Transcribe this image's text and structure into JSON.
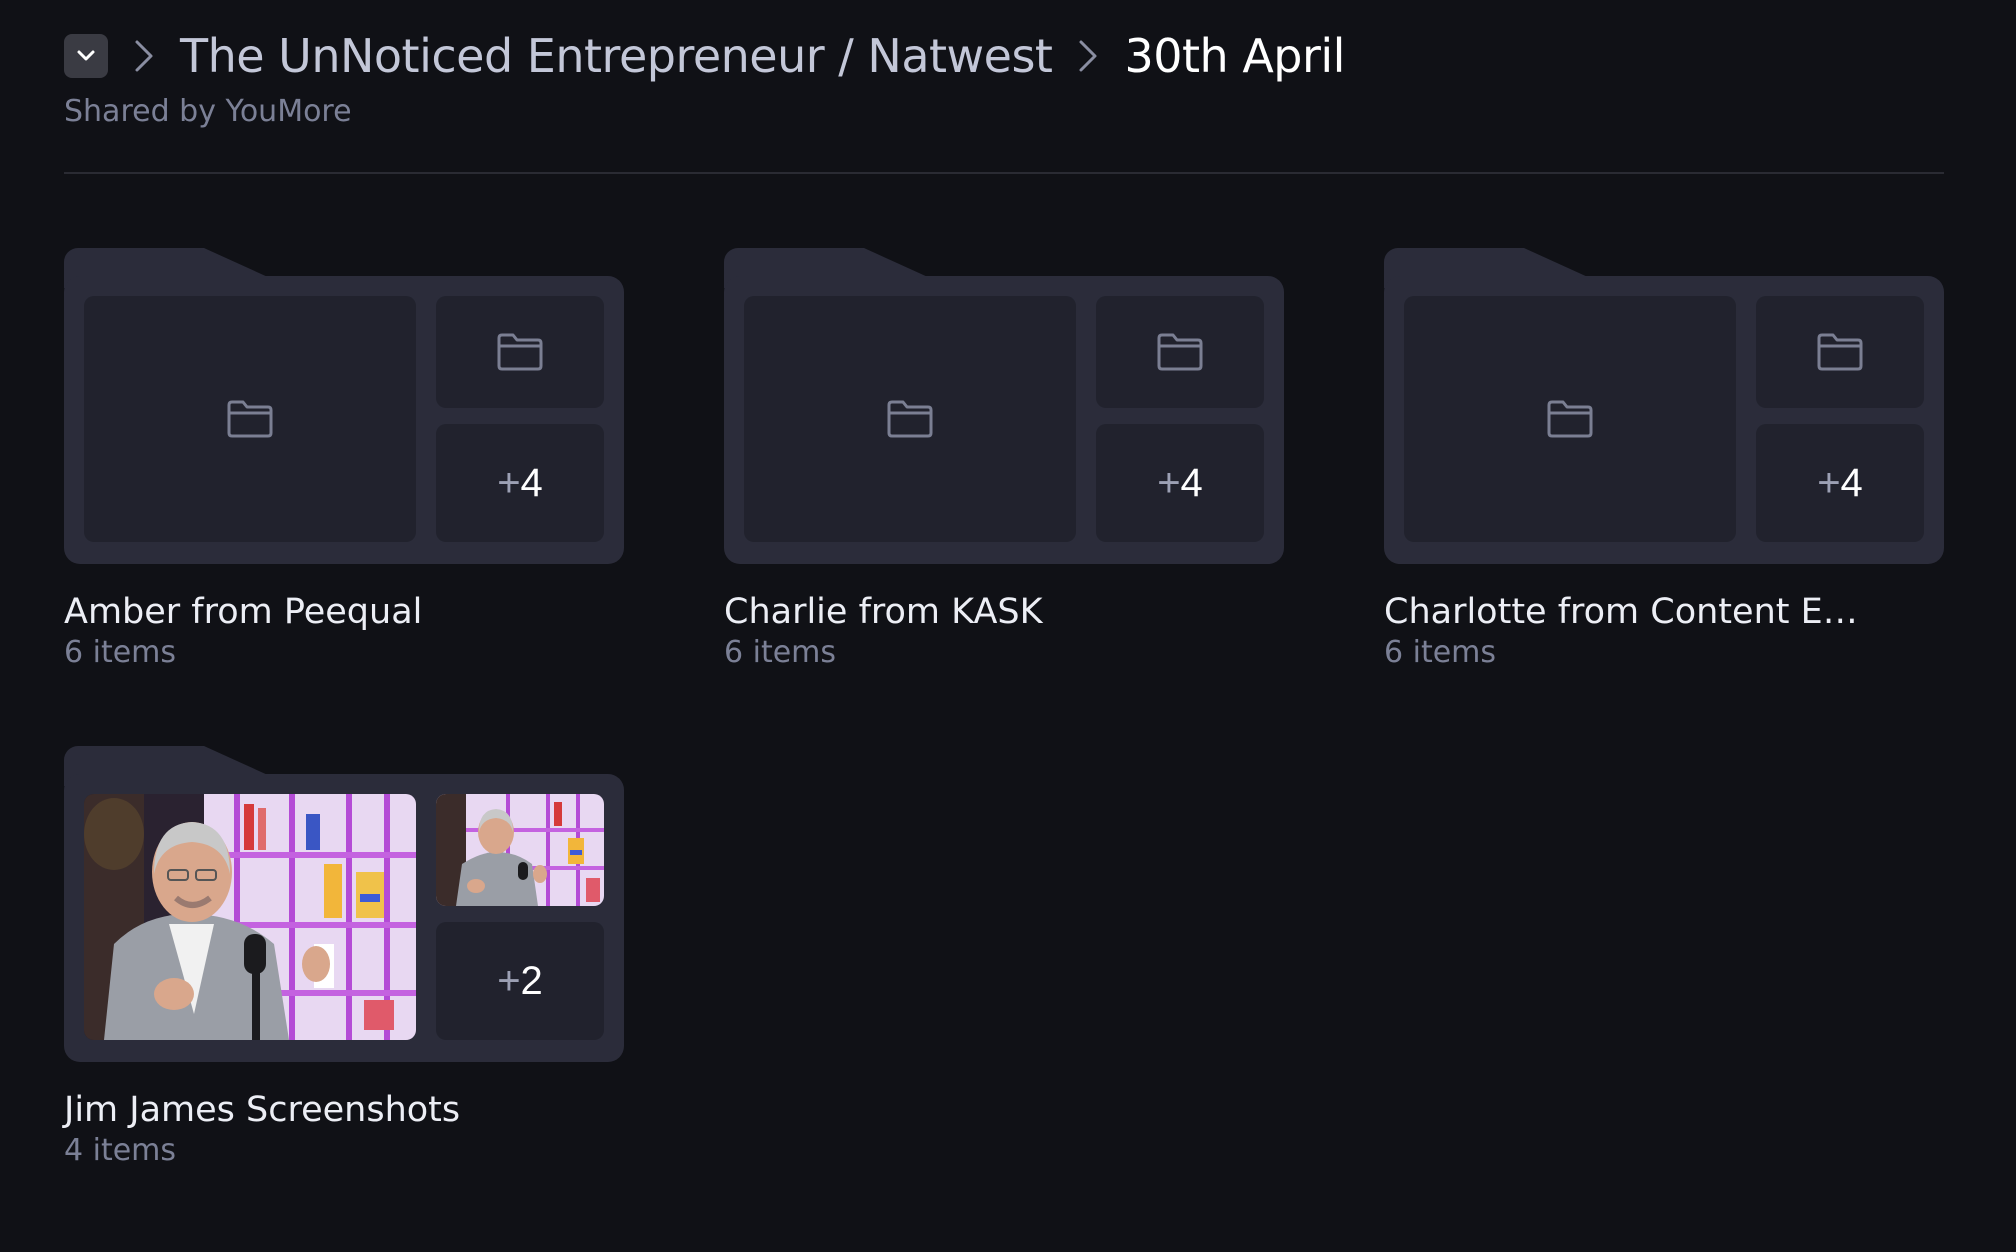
{
  "header": {
    "parent_crumb": "The UnNoticed Entrepreneur / Natwest",
    "current_crumb": "30th April",
    "shared_by": "Shared by YouMore",
    "collapse_icon": "chevron-down-icon",
    "separator_icon": "chevron-right-icon"
  },
  "folders": [
    {
      "name": "Amber from Peequal",
      "count": "6 items",
      "more": "4",
      "thumbnail": "folder-icon"
    },
    {
      "name": "Charlie from KASK",
      "count": "6 items",
      "more": "4",
      "thumbnail": "folder-icon"
    },
    {
      "name": "Charlotte from Content E…",
      "count": "6 items",
      "more": "4",
      "thumbnail": "folder-icon"
    },
    {
      "name": "Jim James Screenshots",
      "count": "4 items",
      "more": "2",
      "thumbnail": "photo"
    }
  ],
  "colors": {
    "background": "#101116",
    "card": "#2b2c3a",
    "tile": "#21222d",
    "muted_text": "#7b8096",
    "accent_purple": "#b44bd6"
  }
}
